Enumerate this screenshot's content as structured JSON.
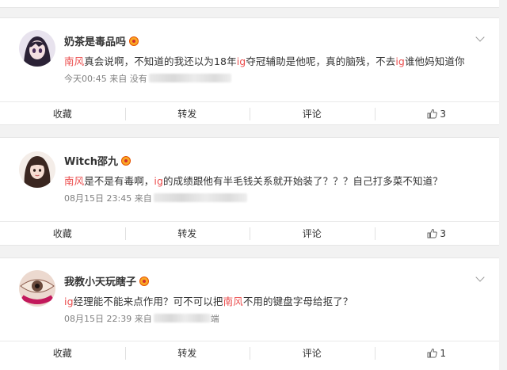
{
  "posts": [
    {
      "username": "奶茶是毒品吗",
      "content": [
        {
          "text": "南风",
          "highlight": true
        },
        {
          "text": "真会说啊，不知道的我还以为18年",
          "highlight": false
        },
        {
          "text": "ig",
          "highlight": true
        },
        {
          "text": "夺冠辅助是他呢，真的脑残，不去",
          "highlight": false
        },
        {
          "text": "ig",
          "highlight": true
        },
        {
          "text": "谁他妈知道你",
          "highlight": false
        }
      ],
      "time": "今天00:45",
      "source_prefix": "来自 没有",
      "source_suffix": "",
      "actions": {
        "collect": "收藏",
        "repost": "转发",
        "comment": "评论",
        "like_count": "3"
      }
    },
    {
      "username": "Witch邵九",
      "content": [
        {
          "text": "南风",
          "highlight": true
        },
        {
          "text": "是不是有毒啊，",
          "highlight": false
        },
        {
          "text": "ig",
          "highlight": true
        },
        {
          "text": "的成绩跟他有半毛钱关系就开始装了？？？自己打多菜不知道？",
          "highlight": false
        }
      ],
      "time": "08月15日 23:45",
      "source_prefix": "来自",
      "source_suffix": "",
      "actions": {
        "collect": "收藏",
        "repost": "转发",
        "comment": "评论",
        "like_count": "3"
      }
    },
    {
      "username": "我教小天玩瞎子",
      "content": [
        {
          "text": "ig",
          "highlight": true
        },
        {
          "text": "经理能不能来点作用？可不可以把",
          "highlight": false
        },
        {
          "text": "南风",
          "highlight": true
        },
        {
          "text": "不用的键盘字母给抠了？",
          "highlight": false
        }
      ],
      "time": "08月15日 22:39",
      "source_prefix": "来自",
      "source_suffix": "端",
      "actions": {
        "collect": "收藏",
        "repost": "转发",
        "comment": "评论",
        "like_count": "1"
      }
    }
  ],
  "colors": {
    "highlight": "#eb4c4c",
    "meta": "#808080",
    "background": "#f2f2f2"
  }
}
